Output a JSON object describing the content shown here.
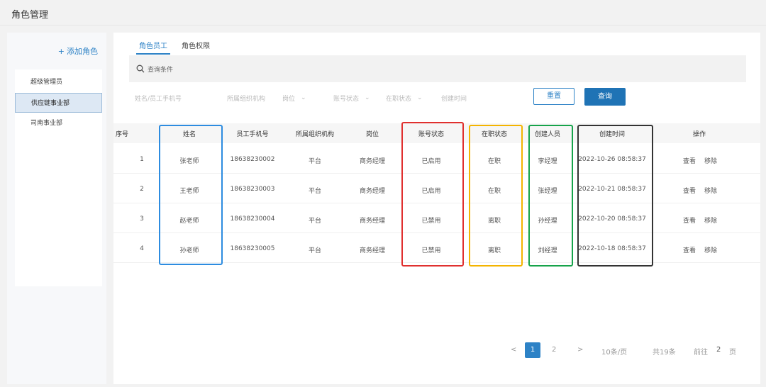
{
  "header": {
    "title": "角色管理"
  },
  "sidebar": {
    "add_role_label": "添加角色",
    "items": [
      {
        "label": "超级管理员"
      },
      {
        "label": "供应链事业部"
      },
      {
        "label": "司南事业部"
      }
    ]
  },
  "tabs": [
    {
      "label": "角色员工"
    },
    {
      "label": "角色权限"
    }
  ],
  "search": {
    "label": "查询条件"
  },
  "filters": [
    {
      "placeholder": "姓名/员工手机号"
    },
    {
      "placeholder": "所属组织机构"
    },
    {
      "placeholder": "岗位"
    },
    {
      "placeholder": "账号状态"
    },
    {
      "placeholder": "在职状态"
    },
    {
      "placeholder": "创建时间"
    }
  ],
  "buttons": {
    "reset": "重置",
    "query": "查询"
  },
  "table": {
    "headers": [
      "序号",
      "姓名",
      "员工手机号",
      "所属组织机构",
      "岗位",
      "账号状态",
      "在职状态",
      "创建人员",
      "创建时间",
      "操作"
    ],
    "rows": [
      {
        "index": "1",
        "name": "张老师",
        "phone": "18638230002",
        "org": "平台",
        "post": "商务经理",
        "account_status": "已启用",
        "job_status": "在职",
        "creator": "李经理",
        "created": "2022-10-26 08:58:37",
        "view": "查看",
        "remove": "移除"
      },
      {
        "index": "2",
        "name": "王老师",
        "phone": "18638230003",
        "org": "平台",
        "post": "商务经理",
        "account_status": "已启用",
        "job_status": "在职",
        "creator": "张经理",
        "created": "2022-10-21 08:58:37",
        "view": "查看",
        "remove": "移除"
      },
      {
        "index": "3",
        "name": "赵老师",
        "phone": "18638230004",
        "org": "平台",
        "post": "商务经理",
        "account_status": "已禁用",
        "job_status": "离职",
        "creator": "孙经理",
        "created": "2022-10-20 08:58:37",
        "view": "查看",
        "remove": "移除"
      },
      {
        "index": "4",
        "name": "孙老师",
        "phone": "18638230005",
        "org": "平台",
        "post": "商务经理",
        "account_status": "已禁用",
        "job_status": "离职",
        "creator": "刘经理",
        "created": "2022-10-18 08:58:37",
        "view": "查看",
        "remove": "移除"
      }
    ]
  },
  "pagination": {
    "prev": "<",
    "pages": [
      "1",
      "2"
    ],
    "next": ">",
    "page_size": "10条/页",
    "total": "共19条",
    "goto_label": "前往",
    "goto_value": "2",
    "goto_unit": "页"
  },
  "colors": {
    "accent": "#2d82c6",
    "highlight_name": "#2d8ce0",
    "highlight_account": "#e0302f",
    "highlight_job": "#f4b400",
    "highlight_creator": "#16a34a",
    "highlight_created": "#333333"
  },
  "icons": {
    "search": "search-icon"
  }
}
